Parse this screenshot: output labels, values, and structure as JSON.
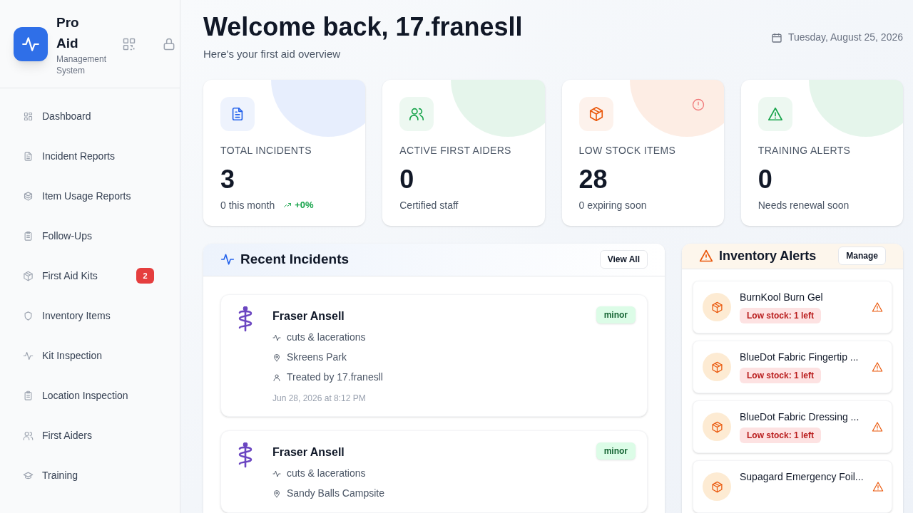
{
  "brand": {
    "name": "Pro Aid",
    "tagline": "Management System"
  },
  "nav": [
    {
      "label": "Dashboard",
      "kind": "grid"
    },
    {
      "label": "Incident Reports",
      "kind": "file"
    },
    {
      "label": "Item Usage Reports",
      "kind": "boxes"
    },
    {
      "label": "Follow-Ups",
      "kind": "clipboard"
    },
    {
      "label": "First Aid Kits",
      "kind": "box",
      "badge": "2"
    },
    {
      "label": "Inventory Items",
      "kind": "shield"
    },
    {
      "label": "Kit Inspection",
      "kind": "pulse"
    },
    {
      "label": "Location Inspection",
      "kind": "clipboard"
    },
    {
      "label": "First Aiders",
      "kind": "users"
    },
    {
      "label": "Training",
      "kind": "cap"
    }
  ],
  "header": {
    "title": "Welcome back, 17.franesll",
    "subtitle": "Here's your first aid overview",
    "date": "Tuesday, August 25, 2026"
  },
  "stats": [
    {
      "kind": "file",
      "color": "#2563eb",
      "label": "TOTAL INCIDENTS",
      "value": "3",
      "note": "0 this month",
      "trend": "+0%",
      "flagged": false
    },
    {
      "kind": "users",
      "color": "#16a34a",
      "label": "ACTIVE FIRST AIDERS",
      "value": "0",
      "note": "Certified staff",
      "flagged": false
    },
    {
      "kind": "box",
      "color": "#ea580c",
      "label": "LOW STOCK ITEMS",
      "value": "28",
      "note": "0 expiring soon",
      "flagged": true
    },
    {
      "kind": "alert",
      "color": "#16a34a",
      "label": "TRAINING ALERTS",
      "value": "0",
      "note": "Needs renewal soon",
      "flagged": false
    }
  ],
  "recent_incidents": {
    "title": "Recent Incidents",
    "action": "View All",
    "items": [
      {
        "name": "Fraser Ansell",
        "severity": "minor",
        "injury": "cuts & lacerations",
        "location": "Skreens Park",
        "treated_by": "Treated by 17.franesll",
        "time": "Jun 28, 2026 at 8:12 PM"
      },
      {
        "name": "Fraser Ansell",
        "severity": "minor",
        "injury": "cuts & lacerations",
        "location": "Sandy Balls Campsite"
      }
    ]
  },
  "inventory_alerts": {
    "title": "Inventory Alerts",
    "action": "Manage",
    "items": [
      {
        "name": "BurnKool Burn Gel",
        "status": "Low stock: 1 left"
      },
      {
        "name": "BlueDot Fabric Fingertip ...",
        "status": "Low stock: 1 left"
      },
      {
        "name": "BlueDot Fabric Dressing ...",
        "status": "Low stock: 1 left"
      },
      {
        "name": "Supagard Emergency Foil..."
      }
    ]
  }
}
